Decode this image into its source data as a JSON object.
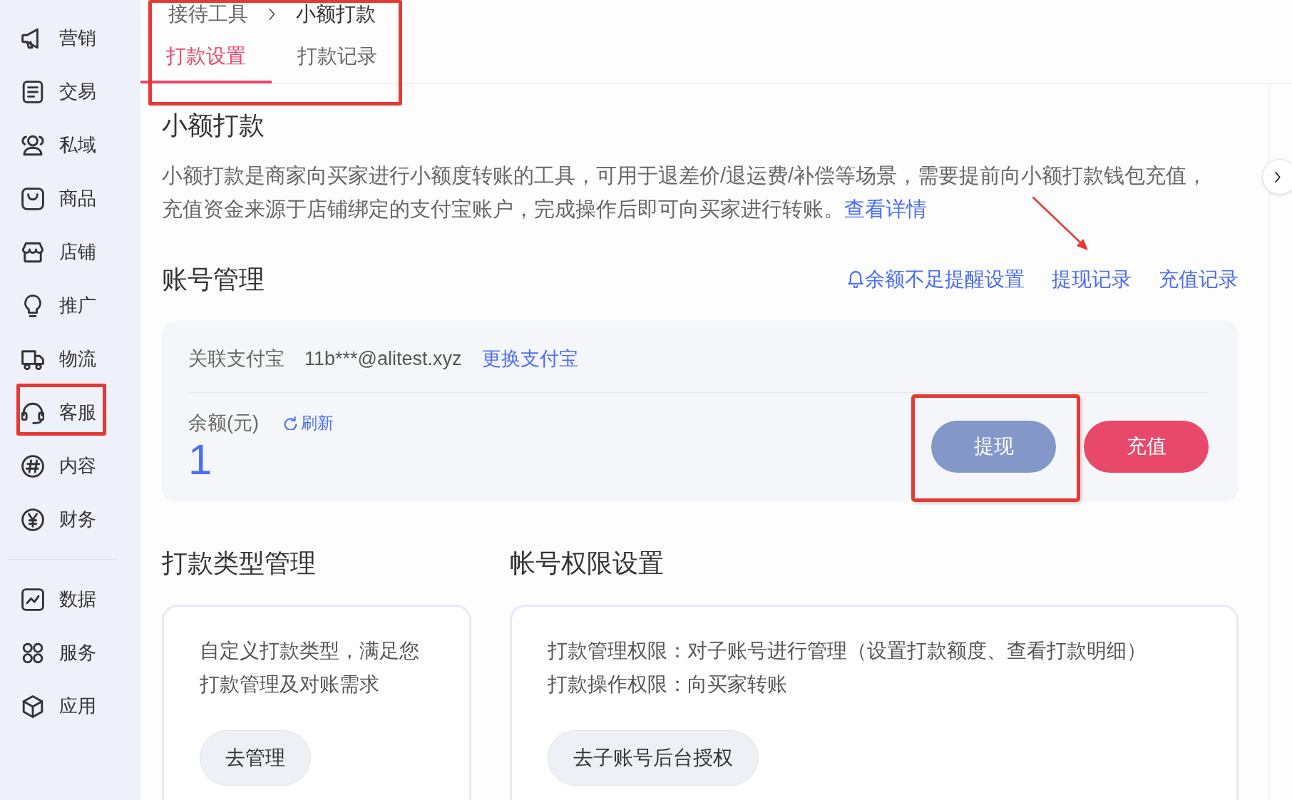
{
  "sidebar": {
    "sections": [
      {
        "items": [
          {
            "label": "营销",
            "selected": false,
            "highlighted": false
          },
          {
            "label": "交易",
            "selected": false,
            "highlighted": false
          },
          {
            "label": "私域",
            "selected": false,
            "highlighted": false
          },
          {
            "label": "商品",
            "selected": false,
            "highlighted": false
          },
          {
            "label": "店铺",
            "selected": false,
            "highlighted": false
          },
          {
            "label": "推广",
            "selected": false,
            "highlighted": false
          },
          {
            "label": "物流",
            "selected": false,
            "highlighted": false
          },
          {
            "label": "客服",
            "selected": false,
            "highlighted": true
          },
          {
            "label": "内容",
            "selected": false,
            "highlighted": false
          },
          {
            "label": "财务",
            "selected": false,
            "highlighted": false
          }
        ]
      },
      {
        "items": [
          {
            "label": "数据",
            "selected": false,
            "highlighted": false
          },
          {
            "label": "服务",
            "selected": false,
            "highlighted": false
          },
          {
            "label": "应用",
            "selected": false,
            "highlighted": false
          }
        ]
      }
    ]
  },
  "header": {
    "highlighted": true,
    "breadcrumb": [
      "接待工具",
      "小额打款"
    ],
    "tabs": [
      {
        "label": "打款设置",
        "selected": true
      },
      {
        "label": "打款记录",
        "selected": false
      }
    ]
  },
  "intro": {
    "title": "小额打款",
    "description": "小额打款是商家向买家进行小额度转账的工具，可用于退差价/退运费/补偿等场景，需要提前向小额打款钱包充值，充值资金来源于店铺绑定的支付宝账户，完成操作后即可向买家进行转账。",
    "link": "查看详情"
  },
  "account": {
    "title": "账号管理",
    "links": [
      {
        "label": "余额不足提醒设置",
        "kind": "reminder",
        "arrow": false
      },
      {
        "label": "提现记录",
        "kind": "record",
        "arrow": true
      },
      {
        "label": "充值记录",
        "kind": "record",
        "arrow": false
      }
    ],
    "alipay_label": "关联支付宝",
    "alipay_account": "11b***@alitest.xyz",
    "change_link": "更换支付宝",
    "balance_label": "余额(元)",
    "refresh": "刷新",
    "balance": "1",
    "buttons": [
      {
        "label": "提现",
        "kind": "withdraw",
        "disabled": true,
        "highlighted": true
      },
      {
        "label": "充值",
        "kind": "recharge",
        "disabled": false,
        "highlighted": false
      }
    ]
  },
  "payment_types": {
    "title": "打款类型管理",
    "description": "自定义打款类型，满足您打款管理及对账需求",
    "button": "去管理"
  },
  "permissions": {
    "title": "帐号权限设置",
    "lines": [
      "打款管理权限：对子账号进行管理（设置打款额度、查看打款明细）",
      "打款操作权限：向买家转账"
    ],
    "button": "去子账号后台授权"
  }
}
